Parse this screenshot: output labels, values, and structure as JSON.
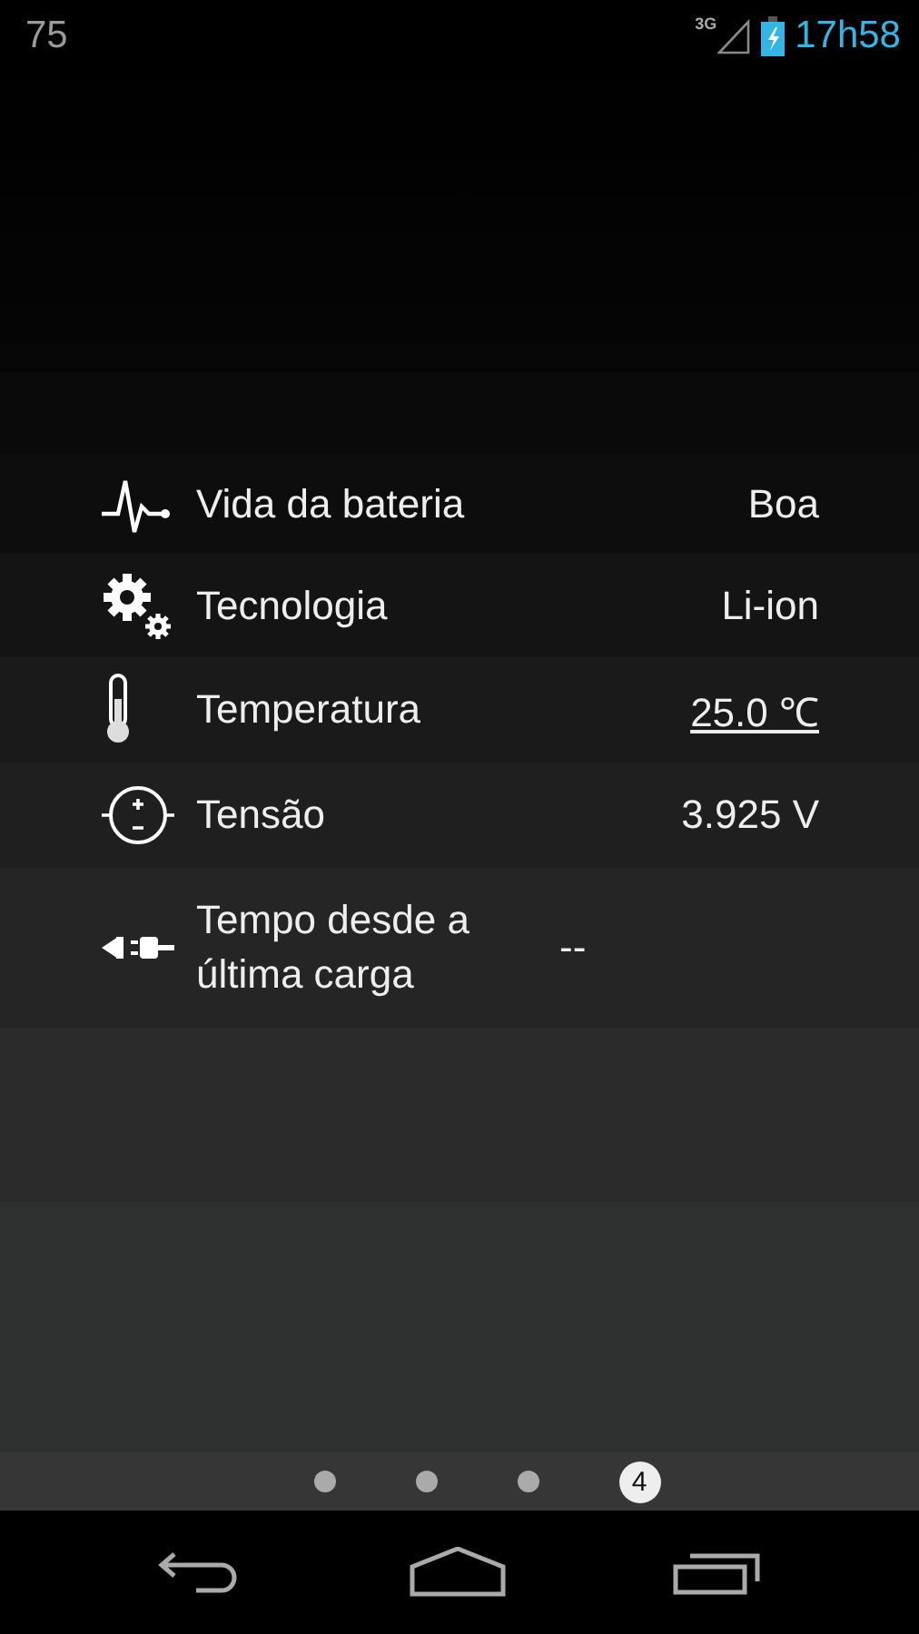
{
  "status_bar": {
    "notification": "75",
    "network": "3G",
    "battery_charging": true,
    "time": "17h58"
  },
  "rows": [
    {
      "kind": "pulse",
      "label": "Vida da bateria",
      "value": "Boa",
      "link": false
    },
    {
      "kind": "gears",
      "label": "Tecnologia",
      "value": "Li-ion",
      "link": false
    },
    {
      "kind": "thermometer",
      "label": "Temperatura",
      "value": "25.0 ℃",
      "link": true
    },
    {
      "kind": "voltage",
      "label": "Tensão",
      "value": "3.925 V",
      "link": false
    },
    {
      "kind": "plug",
      "label": "Tempo desde a última carga",
      "value": "--",
      "link": false
    }
  ],
  "pages": [
    {
      "selected": false
    },
    {
      "selected": false
    },
    {
      "selected": false
    },
    {
      "label": "4",
      "selected": true
    }
  ]
}
